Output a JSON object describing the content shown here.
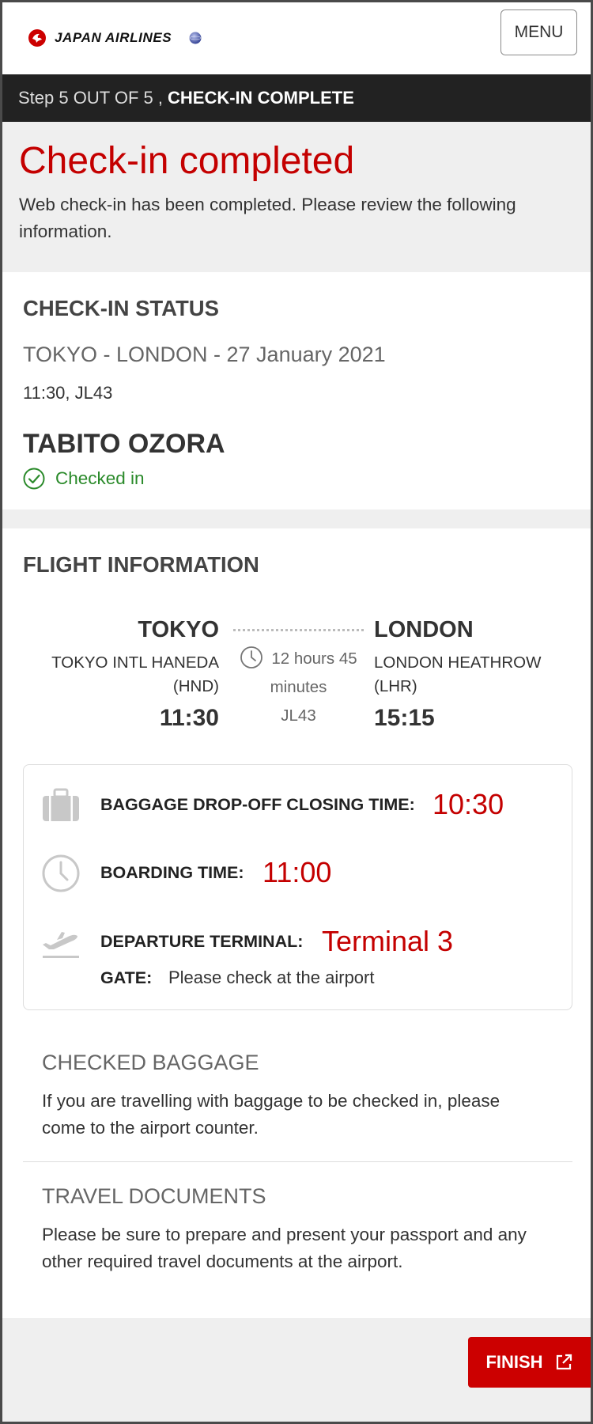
{
  "header": {
    "brand": "JAPAN AIRLINES",
    "menu_label": "MENU"
  },
  "stepbar": {
    "step_text": "Step 5 OUT OF 5 ,",
    "step_name": "CHECK-IN COMPLETE"
  },
  "intro": {
    "title": "Check-in completed",
    "message": "Web check-in has been completed. Please review the following information."
  },
  "checkin_status": {
    "title": "CHECK-IN STATUS",
    "route": "TOKYO - LONDON - 27 January 2021",
    "flight": "11:30, JL43",
    "passenger": "TABITO OZORA",
    "status": "Checked in"
  },
  "flight_info": {
    "title": "FLIGHT INFORMATION",
    "departure": {
      "city": "TOKYO",
      "airport": "TOKYO INTL HANEDA (HND)",
      "time": "11:30"
    },
    "arrival": {
      "city": "LONDON",
      "airport": "LONDON HEATHROW (LHR)",
      "time": "15:15"
    },
    "duration_1": "12 hours 45",
    "duration_2": "minutes",
    "flight_number": "JL43",
    "baggage_label": "BAGGAGE DROP-OFF CLOSING TIME:",
    "baggage_time": "10:30",
    "boarding_label": "BOARDING TIME:",
    "boarding_time": "11:00",
    "terminal_label": "DEPARTURE TERMINAL:",
    "terminal_value": "Terminal 3",
    "gate_label": "GATE:",
    "gate_value": "Please check at the airport"
  },
  "checked_baggage": {
    "title": "CHECKED BAGGAGE",
    "text": "If you are travelling with baggage to be checked in, please come to the airport counter."
  },
  "travel_documents": {
    "title": "TRAVEL DOCUMENTS",
    "text": "Please be sure to prepare and present your passport and any other required travel documents at the airport."
  },
  "footer": {
    "finish_label": "FINISH"
  },
  "colors": {
    "accent_red": "#c40000",
    "success_green": "#2a8a2a",
    "stepbar_bg": "#222222"
  }
}
